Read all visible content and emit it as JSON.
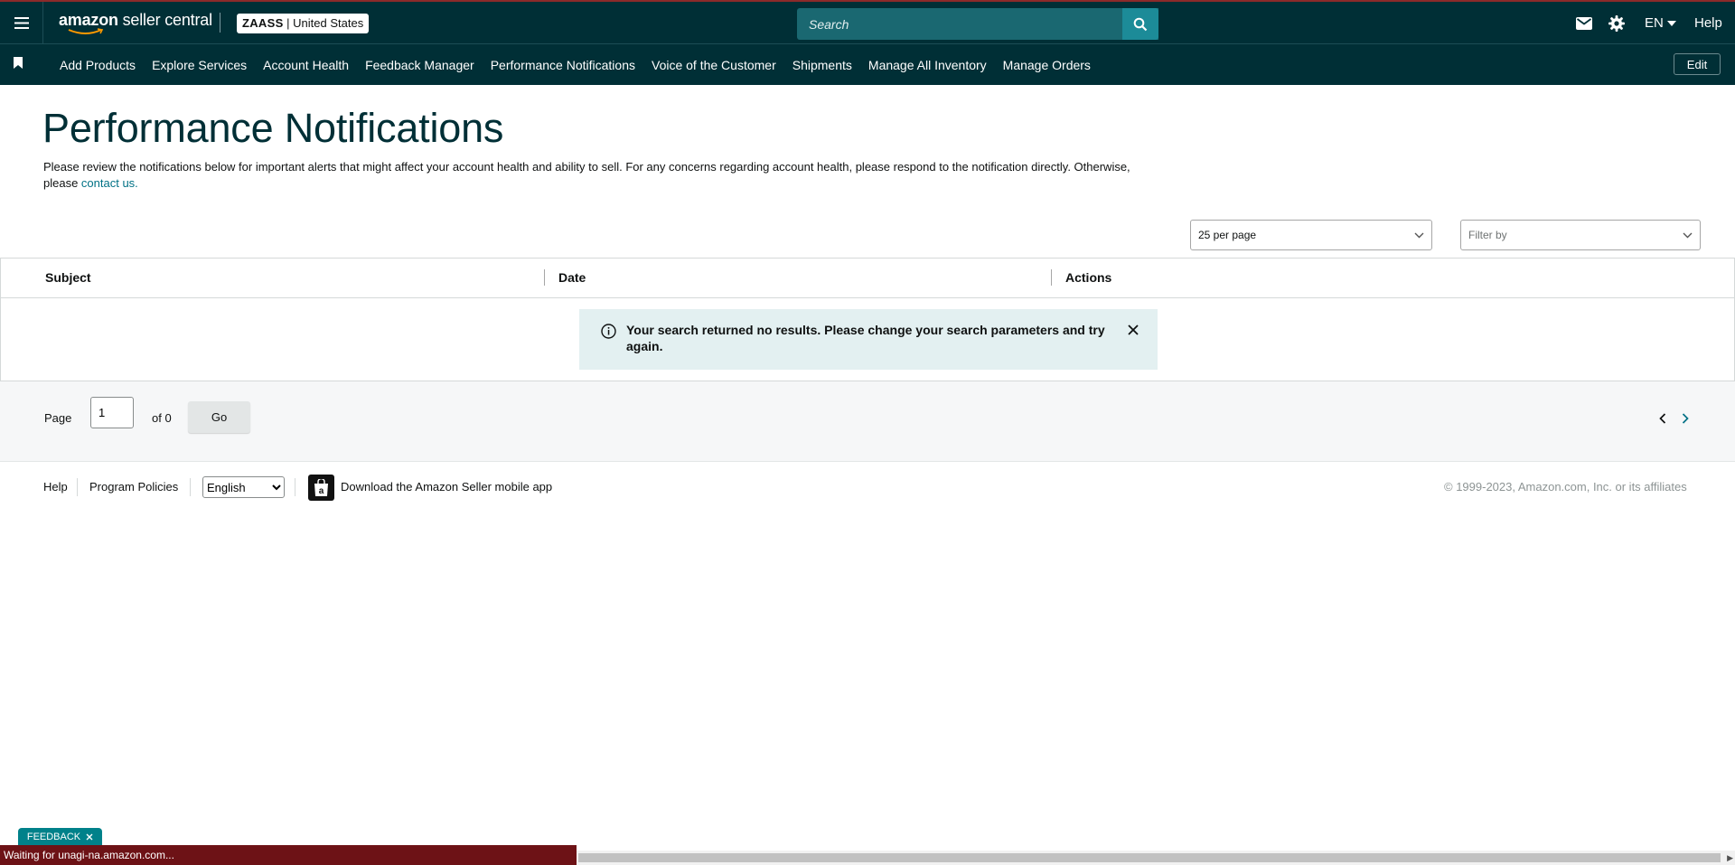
{
  "header": {
    "logo_brand": "amazon",
    "logo_suffix": " seller central",
    "store_name": "ZAASS",
    "store_region": " | United States",
    "search_placeholder": "Search",
    "language": "EN",
    "help": "Help"
  },
  "nav": {
    "items": [
      "Add Products",
      "Explore Services",
      "Account Health",
      "Feedback Manager",
      "Performance Notifications",
      "Voice of the Customer",
      "Shipments",
      "Manage All Inventory",
      "Manage Orders"
    ],
    "edit_label": "Edit"
  },
  "page": {
    "title": "Performance Notifications",
    "intro_text": "Please review the notifications below for important alerts that might affect your account health and ability to sell. For any concerns regarding account health, please respond to the notification directly. Otherwise, please ",
    "intro_link": "contact us."
  },
  "controls": {
    "per_page": "25 per page",
    "filter_placeholder": "Filter by"
  },
  "table": {
    "columns": [
      "Subject",
      "Date",
      "Actions"
    ],
    "empty_message": "Your search returned no results. Please change your search parameters and try again."
  },
  "pagination": {
    "page_label": "Page",
    "current_page": "1",
    "of_label": "of 0",
    "go_label": "Go"
  },
  "footer": {
    "help": "Help",
    "program_policies": "Program Policies",
    "language_selected": "English",
    "app_download": "Download the Amazon Seller mobile app",
    "copyright": "© 1999-2023, Amazon.com, Inc. or its affiliates"
  },
  "feedback_tab": "FEEDBACK",
  "status_bar": "Waiting for unagi-na.amazon.com...",
  "colors": {
    "header_bg": "#002f36",
    "search_btn": "#1c8b98",
    "link": "#007185",
    "alert_bg": "#e3f0f1",
    "feedback_tab": "#00818a",
    "status_bar": "#6d1216"
  },
  "icons": [
    "hamburger-icon",
    "search-icon",
    "mail-icon",
    "gear-icon",
    "caret-down-icon",
    "bookmark-icon",
    "chevron-down-icon",
    "info-icon",
    "close-icon",
    "chevron-left-icon",
    "chevron-right-icon",
    "amazon-app-icon"
  ]
}
